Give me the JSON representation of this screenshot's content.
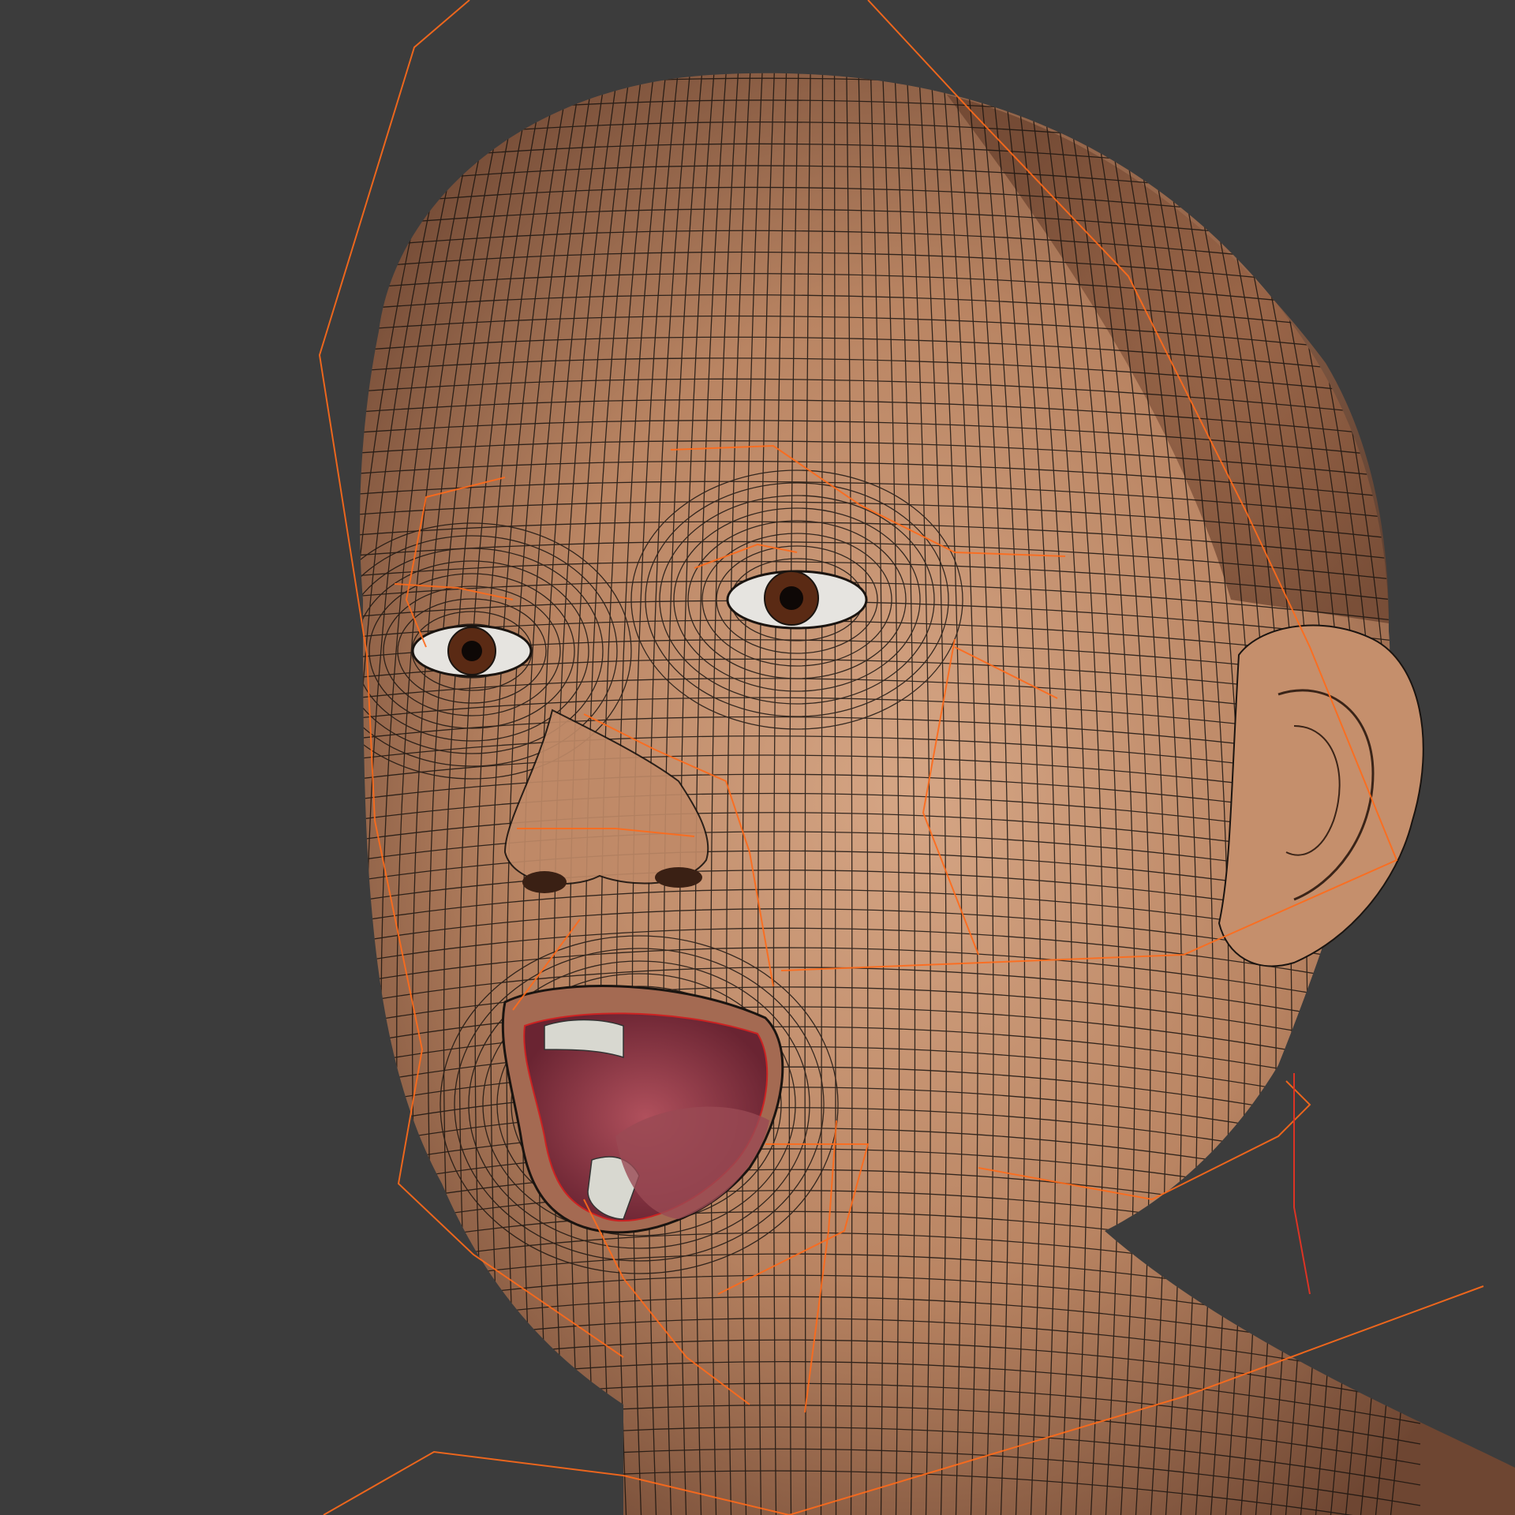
{
  "viewport": {
    "background": "#3c3c3c",
    "content": "3d-head-wireframe",
    "colors": {
      "skin_light": "#c99a7a",
      "skin_mid": "#b07a58",
      "skin_dark": "#7a5038",
      "scalp": "#8a5a3e",
      "wire": "#1a1410",
      "rig": "#ff6a1a",
      "mouth": "#8e3a45",
      "teeth": "#d8d8d0",
      "iris": "#5a2a14"
    }
  }
}
